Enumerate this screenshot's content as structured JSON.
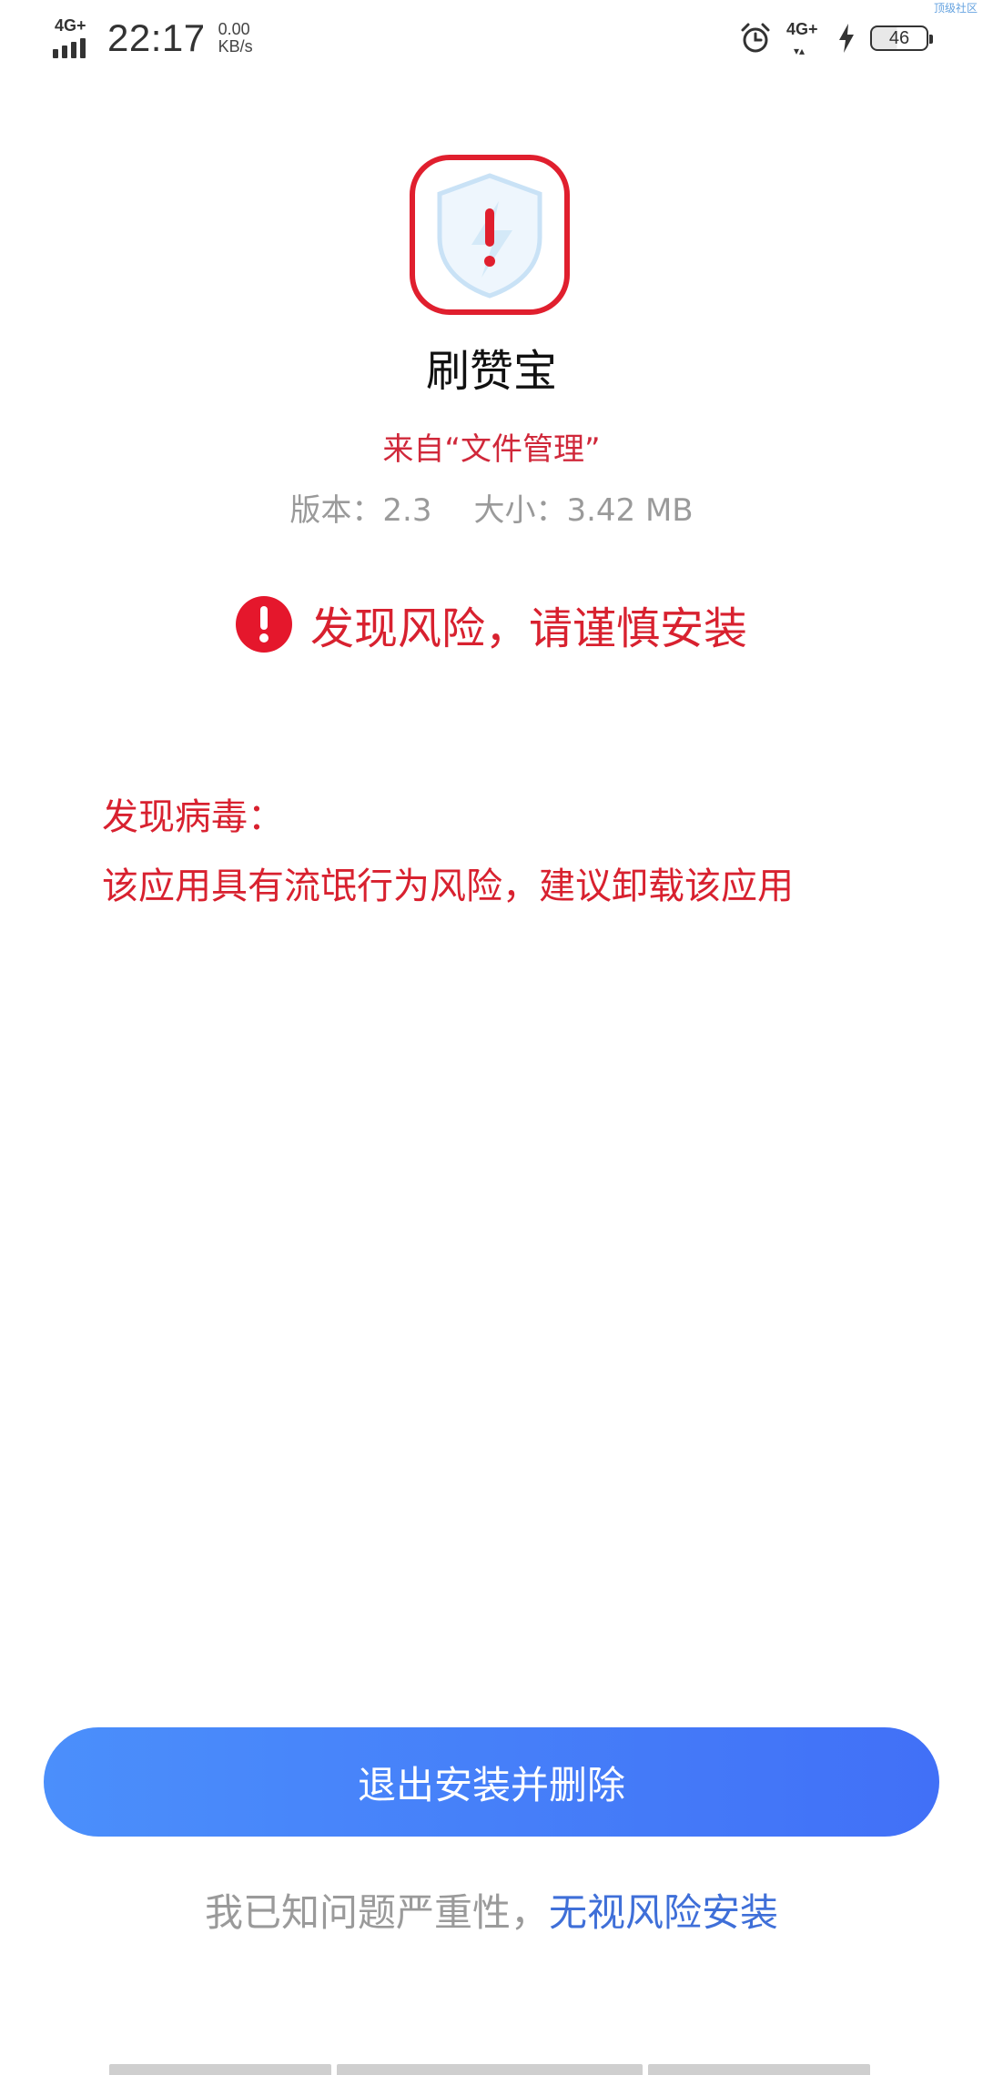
{
  "status_bar": {
    "network_left": "4G+",
    "time": "22:17",
    "speed_value": "0.00",
    "speed_unit": "KB/s",
    "network_right": "4G+",
    "battery_level": "46",
    "watermark": "顶级社区"
  },
  "app": {
    "name": "刷赞宝",
    "source": "来自“文件管理”",
    "version": "版本：2.3",
    "size": "大小：3.42 MB"
  },
  "risk": {
    "title": "发现风险，请谨慎安装",
    "virus_heading": "发现病毒：",
    "virus_detail": "该应用具有流氓行为风险，建议卸载该应用"
  },
  "actions": {
    "exit_button": "退出安装并删除",
    "ack_prefix": "我已知问题严重性，",
    "ignore_link": "无视风险安装"
  },
  "colors": {
    "danger": "#d8212f",
    "primary_start": "#4b8ffb",
    "primary_end": "#4170f7",
    "link": "#3f6fd8",
    "muted": "#9a9a9a"
  },
  "icons": {
    "app_icon": "shield-lightning-warning-icon",
    "warning": "exclamation-circle-icon",
    "alarm": "alarm-clock-icon",
    "charging": "lightning-bolt-icon"
  }
}
